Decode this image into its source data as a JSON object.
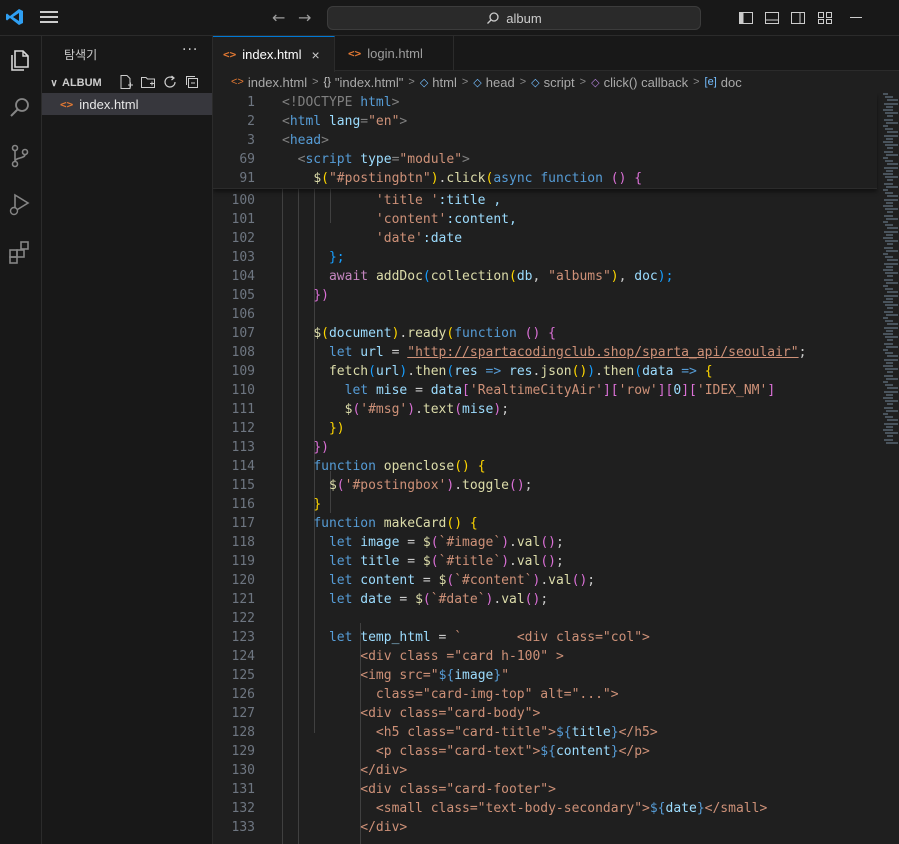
{
  "titlebar": {
    "search_text": "album",
    "back": "←",
    "forward": "→"
  },
  "activity_bar": {
    "items": [
      "explorer-icon",
      "search-icon",
      "source-control-icon",
      "run-debug-icon",
      "extensions-icon"
    ]
  },
  "sidebar": {
    "title": "탐색기",
    "more": "···",
    "folder_name": "ALBUM",
    "files": [
      {
        "name": "index.html",
        "icon": "<>"
      }
    ]
  },
  "tabs": [
    {
      "label": "index.html",
      "icon": "<>",
      "close": "×",
      "active": true
    },
    {
      "label": "login.html",
      "icon": "<>",
      "active": false
    }
  ],
  "breadcrumb": [
    {
      "icon": "<>",
      "label": "index.html"
    },
    {
      "icon": "{}",
      "label": "\"index.html\""
    },
    {
      "icon": "◇",
      "label": "html"
    },
    {
      "icon": "◇",
      "label": "head"
    },
    {
      "icon": "◇",
      "label": "script"
    },
    {
      "icon": "◇",
      "label": "click() callback"
    },
    {
      "icon": "[e]",
      "label": "doc"
    }
  ],
  "colors": {
    "accent": "#0078d4",
    "editor_bg": "#1f1f1f",
    "sidebar_bg": "#181818"
  },
  "sticky_lines": [
    {
      "n": "1",
      "tokens": [
        [
          "<!DOCTYPE ",
          "t-punc"
        ],
        [
          "html",
          "t-tag"
        ],
        [
          ">",
          "t-punc"
        ]
      ]
    },
    {
      "n": "2",
      "tokens": [
        [
          "<",
          "t-punc"
        ],
        [
          "html ",
          "t-tag"
        ],
        [
          "lang",
          "t-attr"
        ],
        [
          "=",
          "t-punc"
        ],
        [
          "\"en\"",
          "t-str"
        ],
        [
          ">",
          "t-punc"
        ]
      ]
    },
    {
      "n": "3",
      "tokens": [
        [
          "<",
          "t-punc"
        ],
        [
          "head",
          "t-tag"
        ],
        [
          ">",
          "t-punc"
        ]
      ]
    },
    {
      "n": "69",
      "tokens": [
        [
          "  <",
          "t-punc"
        ],
        [
          "script ",
          "t-tag"
        ],
        [
          "type",
          "t-attr"
        ],
        [
          "=",
          "t-punc"
        ],
        [
          "\"module\"",
          "t-str"
        ],
        [
          ">",
          "t-punc"
        ]
      ]
    },
    {
      "n": "91",
      "tokens": [
        [
          "    ",
          ""
        ],
        [
          "$",
          "t-fn"
        ],
        [
          "(",
          "t-yel"
        ],
        [
          "\"#postingbtn\"",
          "t-str"
        ],
        [
          ")",
          "t-yel"
        ],
        [
          ".",
          ""
        ],
        [
          "click",
          "t-fn"
        ],
        [
          "(",
          "t-yel"
        ],
        [
          "async ",
          "t-kw"
        ],
        [
          "function ",
          "t-kw"
        ],
        [
          "() {",
          "t-pink"
        ]
      ]
    }
  ],
  "code_lines": [
    {
      "n": "100",
      "tokens": [
        [
          "            ",
          ""
        ],
        [
          "'title '",
          "t-str"
        ],
        [
          ":title ,",
          "t-var"
        ]
      ]
    },
    {
      "n": "101",
      "tokens": [
        [
          "            ",
          ""
        ],
        [
          "'content'",
          "t-str"
        ],
        [
          ":content,",
          "t-var"
        ]
      ]
    },
    {
      "n": "102",
      "tokens": [
        [
          "            ",
          ""
        ],
        [
          "'date'",
          "t-str"
        ],
        [
          ":date",
          "t-var"
        ]
      ]
    },
    {
      "n": "103",
      "tokens": [
        [
          "      ",
          ""
        ],
        [
          "};",
          "t-blue"
        ]
      ]
    },
    {
      "n": "104",
      "tokens": [
        [
          "      ",
          ""
        ],
        [
          "await ",
          "t-ctl"
        ],
        [
          "addDoc",
          "t-fn"
        ],
        [
          "(",
          "t-blue"
        ],
        [
          "collection",
          "t-fn"
        ],
        [
          "(",
          "t-yel"
        ],
        [
          "db",
          "t-var"
        ],
        [
          ", ",
          ""
        ],
        [
          "\"albums\"",
          "t-str"
        ],
        [
          ")",
          "t-yel"
        ],
        [
          ", ",
          ""
        ],
        [
          "doc",
          "t-var"
        ],
        [
          ");",
          "t-blue"
        ]
      ]
    },
    {
      "n": "105",
      "tokens": [
        [
          "    ",
          ""
        ],
        [
          "})",
          "t-pink"
        ]
      ]
    },
    {
      "n": "106",
      "tokens": []
    },
    {
      "n": "107",
      "tokens": [
        [
          "    ",
          ""
        ],
        [
          "$",
          "t-fn"
        ],
        [
          "(",
          "t-yel"
        ],
        [
          "document",
          "t-var"
        ],
        [
          ")",
          "t-yel"
        ],
        [
          ".",
          ""
        ],
        [
          "ready",
          "t-fn"
        ],
        [
          "(",
          "t-yel"
        ],
        [
          "function ",
          "t-kw"
        ],
        [
          "() {",
          "t-pink"
        ]
      ]
    },
    {
      "n": "108",
      "tokens": [
        [
          "      ",
          ""
        ],
        [
          "let ",
          "t-kw"
        ],
        [
          "url",
          "t-var"
        ],
        [
          " = ",
          ""
        ],
        [
          "\"http://spartacodingclub.shop/sparta_api/seoulair\"",
          "t-url"
        ],
        [
          ";",
          ""
        ]
      ]
    },
    {
      "n": "109",
      "tokens": [
        [
          "      ",
          ""
        ],
        [
          "fetch",
          "t-fn"
        ],
        [
          "(",
          "t-blue"
        ],
        [
          "url",
          "t-var"
        ],
        [
          ")",
          "t-blue"
        ],
        [
          ".",
          ""
        ],
        [
          "then",
          "t-fn"
        ],
        [
          "(",
          "t-blue"
        ],
        [
          "res",
          "t-var"
        ],
        [
          " => ",
          "t-kw"
        ],
        [
          "res",
          "t-var"
        ],
        [
          ".",
          ""
        ],
        [
          "json",
          "t-fn"
        ],
        [
          "()",
          "t-yel"
        ],
        [
          ")",
          "t-blue"
        ],
        [
          ".",
          ""
        ],
        [
          "then",
          "t-fn"
        ],
        [
          "(",
          "t-blue"
        ],
        [
          "data",
          "t-var"
        ],
        [
          " => ",
          "t-kw"
        ],
        [
          "{",
          "t-yel"
        ]
      ]
    },
    {
      "n": "110",
      "tokens": [
        [
          "        ",
          ""
        ],
        [
          "let ",
          "t-kw"
        ],
        [
          "mise",
          "t-var"
        ],
        [
          " = ",
          ""
        ],
        [
          "data",
          "t-var"
        ],
        [
          "[",
          "t-pink"
        ],
        [
          "'RealtimeCityAir'",
          "t-str"
        ],
        [
          "][",
          "t-pink"
        ],
        [
          "'row'",
          "t-str"
        ],
        [
          "][",
          "t-pink"
        ],
        [
          "0",
          "t-var"
        ],
        [
          "][",
          "t-pink"
        ],
        [
          "'IDEX_NM'",
          "t-str"
        ],
        [
          "]",
          "t-pink"
        ]
      ]
    },
    {
      "n": "111",
      "tokens": [
        [
          "        ",
          ""
        ],
        [
          "$",
          "t-fn"
        ],
        [
          "(",
          "t-pink"
        ],
        [
          "'#msg'",
          "t-str"
        ],
        [
          ")",
          "t-pink"
        ],
        [
          ".",
          ""
        ],
        [
          "text",
          "t-fn"
        ],
        [
          "(",
          "t-pink"
        ],
        [
          "mise",
          "t-var"
        ],
        [
          ")",
          "t-pink"
        ],
        [
          ";",
          ""
        ]
      ]
    },
    {
      "n": "112",
      "tokens": [
        [
          "      ",
          ""
        ],
        [
          "})",
          "t-yel"
        ]
      ]
    },
    {
      "n": "113",
      "tokens": [
        [
          "    ",
          ""
        ],
        [
          "})",
          "t-pink"
        ]
      ]
    },
    {
      "n": "114",
      "tokens": [
        [
          "    ",
          ""
        ],
        [
          "function ",
          "t-kw"
        ],
        [
          "openclose",
          "t-fn"
        ],
        [
          "() {",
          "t-yel"
        ]
      ]
    },
    {
      "n": "115",
      "tokens": [
        [
          "      ",
          ""
        ],
        [
          "$",
          "t-fn"
        ],
        [
          "(",
          "t-pink"
        ],
        [
          "'#postingbox'",
          "t-str"
        ],
        [
          ")",
          "t-pink"
        ],
        [
          ".",
          ""
        ],
        [
          "toggle",
          "t-fn"
        ],
        [
          "()",
          "t-pink"
        ],
        [
          ";",
          ""
        ]
      ]
    },
    {
      "n": "116",
      "tokens": [
        [
          "    ",
          ""
        ],
        [
          "}",
          "t-yel"
        ]
      ]
    },
    {
      "n": "117",
      "tokens": [
        [
          "    ",
          ""
        ],
        [
          "function ",
          "t-kw"
        ],
        [
          "makeCard",
          "t-fn"
        ],
        [
          "() {",
          "t-yel"
        ]
      ]
    },
    {
      "n": "118",
      "tokens": [
        [
          "      ",
          ""
        ],
        [
          "let ",
          "t-kw"
        ],
        [
          "image",
          "t-var"
        ],
        [
          " = ",
          ""
        ],
        [
          "$",
          "t-fn"
        ],
        [
          "(",
          "t-pink"
        ],
        [
          "`#image`",
          "t-str"
        ],
        [
          ")",
          "t-pink"
        ],
        [
          ".",
          ""
        ],
        [
          "val",
          "t-fn"
        ],
        [
          "()",
          "t-pink"
        ],
        [
          ";",
          ""
        ]
      ]
    },
    {
      "n": "119",
      "tokens": [
        [
          "      ",
          ""
        ],
        [
          "let ",
          "t-kw"
        ],
        [
          "title",
          "t-var"
        ],
        [
          " = ",
          ""
        ],
        [
          "$",
          "t-fn"
        ],
        [
          "(",
          "t-pink"
        ],
        [
          "`#title`",
          "t-str"
        ],
        [
          ")",
          "t-pink"
        ],
        [
          ".",
          ""
        ],
        [
          "val",
          "t-fn"
        ],
        [
          "()",
          "t-pink"
        ],
        [
          ";",
          ""
        ]
      ]
    },
    {
      "n": "120",
      "tokens": [
        [
          "      ",
          ""
        ],
        [
          "let ",
          "t-kw"
        ],
        [
          "content",
          "t-var"
        ],
        [
          " = ",
          ""
        ],
        [
          "$",
          "t-fn"
        ],
        [
          "(",
          "t-pink"
        ],
        [
          "`#content`",
          "t-str"
        ],
        [
          ")",
          "t-pink"
        ],
        [
          ".",
          ""
        ],
        [
          "val",
          "t-fn"
        ],
        [
          "()",
          "t-pink"
        ],
        [
          ";",
          ""
        ]
      ]
    },
    {
      "n": "121",
      "tokens": [
        [
          "      ",
          ""
        ],
        [
          "let ",
          "t-kw"
        ],
        [
          "date",
          "t-var"
        ],
        [
          " = ",
          ""
        ],
        [
          "$",
          "t-fn"
        ],
        [
          "(",
          "t-pink"
        ],
        [
          "`#date`",
          "t-str"
        ],
        [
          ")",
          "t-pink"
        ],
        [
          ".",
          ""
        ],
        [
          "val",
          "t-fn"
        ],
        [
          "()",
          "t-pink"
        ],
        [
          ";",
          ""
        ]
      ]
    },
    {
      "n": "122",
      "tokens": []
    },
    {
      "n": "123",
      "tokens": [
        [
          "      ",
          ""
        ],
        [
          "let ",
          "t-kw"
        ],
        [
          "temp_html",
          "t-var"
        ],
        [
          " = ",
          ""
        ],
        [
          "`       <div class=\"col\">",
          "t-str"
        ]
      ]
    },
    {
      "n": "124",
      "tokens": [
        [
          "          ",
          ""
        ],
        [
          "<div class =\"card h-100\" >",
          "t-str"
        ]
      ]
    },
    {
      "n": "125",
      "tokens": [
        [
          "          ",
          ""
        ],
        [
          "<img src=\"",
          "t-str"
        ],
        [
          "${",
          "t-kw"
        ],
        [
          "image",
          "t-var"
        ],
        [
          "}",
          "t-kw"
        ],
        [
          "\"",
          "t-str"
        ]
      ]
    },
    {
      "n": "126",
      "tokens": [
        [
          "            ",
          ""
        ],
        [
          "class=\"card-img-top\" alt=\"...\">",
          "t-str"
        ]
      ]
    },
    {
      "n": "127",
      "tokens": [
        [
          "          ",
          ""
        ],
        [
          "<div class=\"card-body\">",
          "t-str"
        ]
      ]
    },
    {
      "n": "128",
      "tokens": [
        [
          "            ",
          ""
        ],
        [
          "<h5 class=\"card-title\">",
          "t-str"
        ],
        [
          "${",
          "t-kw"
        ],
        [
          "title",
          "t-var"
        ],
        [
          "}",
          "t-kw"
        ],
        [
          "</h5>",
          "t-str"
        ]
      ]
    },
    {
      "n": "129",
      "tokens": [
        [
          "            ",
          ""
        ],
        [
          "<p class=\"card-text\">",
          "t-str"
        ],
        [
          "${",
          "t-kw"
        ],
        [
          "content",
          "t-var"
        ],
        [
          "}",
          "t-kw"
        ],
        [
          "</p>",
          "t-str"
        ]
      ]
    },
    {
      "n": "130",
      "tokens": [
        [
          "          ",
          ""
        ],
        [
          "</div>",
          "t-str"
        ]
      ]
    },
    {
      "n": "131",
      "tokens": [
        [
          "          ",
          ""
        ],
        [
          "<div class=\"card-footer\">",
          "t-str"
        ]
      ]
    },
    {
      "n": "132",
      "tokens": [
        [
          "            ",
          ""
        ],
        [
          "<small class=\"text-body-secondary\">",
          "t-str"
        ],
        [
          "${",
          "t-kw"
        ],
        [
          "date",
          "t-var"
        ],
        [
          "}",
          "t-kw"
        ],
        [
          "</small>",
          "t-str"
        ]
      ]
    },
    {
      "n": "133",
      "tokens": [
        [
          "          ",
          ""
        ],
        [
          "</div>",
          "t-str"
        ]
      ]
    }
  ]
}
